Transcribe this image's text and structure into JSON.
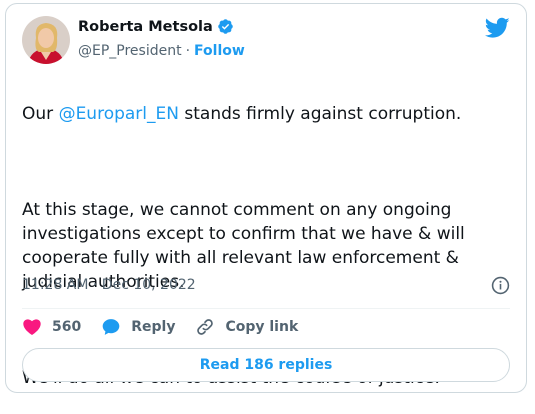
{
  "author": {
    "name": "Roberta Metsola",
    "handle": "@EP_President",
    "separator": "·",
    "follow_label": "Follow"
  },
  "tweet": {
    "intro_prefix": "Our ",
    "mention": "@Europarl_EN",
    "intro_suffix": " stands firmly against corruption.",
    "paragraph2": "At this stage, we cannot comment on any ongoing investigations except to confirm that we have & will cooperate fully with all relevant law enforcement & judicial authorities.",
    "paragraph3": "We'll do all we can to assist the course of justice."
  },
  "meta": {
    "timestamp": "11:28 AM · Dec 10, 2022"
  },
  "actions": {
    "like_count": "560",
    "reply_label": "Reply",
    "copy_link_label": "Copy link"
  },
  "footer": {
    "read_replies_label": "Read 186 replies"
  },
  "colors": {
    "accent": "#1d9bf0",
    "like": "#f91880",
    "muted": "#536471"
  },
  "icons": {
    "verified": "verified-badge-icon",
    "logo": "twitter-bird-icon",
    "info": "info-icon",
    "like": "heart-icon",
    "reply": "reply-bubble-icon",
    "copy": "link-icon"
  }
}
